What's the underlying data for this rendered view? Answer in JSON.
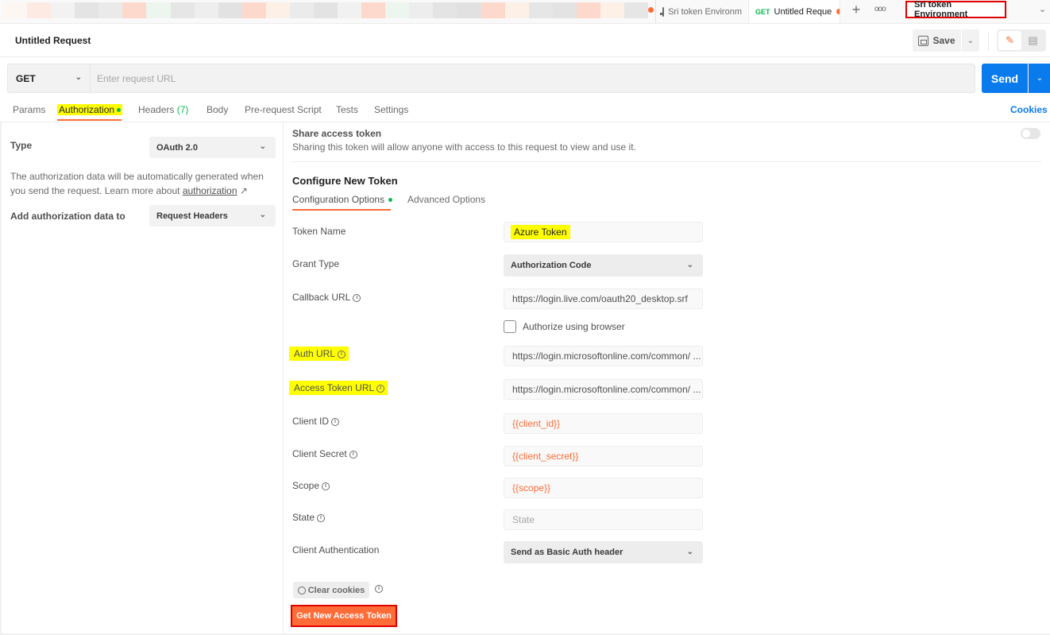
{
  "tabstrip": {
    "env_tab_label": "Sri token Environm",
    "active_tab_method": "GET",
    "active_tab_label": "Untitled Reque",
    "new_tab_icon": "+",
    "more_icon": "ooo",
    "environment_selector": "Sri token Environment",
    "env_chevron": "⌄"
  },
  "header": {
    "title": "Untitled Request",
    "save_label": "Save",
    "chevron": "⌄",
    "edit_icon": "✎",
    "comment_icon": "▤"
  },
  "url_bar": {
    "method": "GET",
    "method_chevron": "⌄",
    "url_value": "",
    "url_placeholder": "Enter request URL",
    "send_label": "Send",
    "send_chevron": "⌄"
  },
  "request_tabs": {
    "params": "Params",
    "authorization": "Authorization",
    "headers": "Headers",
    "headers_count": "(7)",
    "body": "Body",
    "pre_request": "Pre-request Script",
    "tests": "Tests",
    "settings": "Settings",
    "cookies": "Cookies"
  },
  "left_panel": {
    "type_label": "Type",
    "type_value": "OAuth 2.0",
    "description": "The authorization data will be automatically generated when you send the request. Learn more about ",
    "description_link": "authorization",
    "link_arrow": "↗",
    "add_to_label": "Add authorization data to",
    "add_to_value": "Request Headers",
    "chevron": "⌄"
  },
  "right_panel": {
    "share_title": "Share access token",
    "share_desc": "Sharing this token will allow anyone with access to this request to view and use it.",
    "share_enabled": false,
    "configure_title": "Configure New Token",
    "subtabs": {
      "config": "Configuration Options",
      "advanced": "Advanced Options"
    },
    "info_glyph": "i",
    "chevron": "⌄",
    "fields": {
      "token_name": {
        "label": "Token Name",
        "value": "Azure Token"
      },
      "grant_type": {
        "label": "Grant Type",
        "value": "Authorization Code"
      },
      "callback_url": {
        "label": "Callback URL",
        "value": "https://login.live.com/oauth20_desktop.srf"
      },
      "authorize_browser": {
        "label": "Authorize using browser",
        "checked": false
      },
      "auth_url": {
        "label": "Auth URL",
        "value": "https://login.microsoftonline.com/common/ ..."
      },
      "access_token_url": {
        "label": "Access Token URL",
        "value": "https://login.microsoftonline.com/common/ ..."
      },
      "client_id": {
        "label": "Client ID",
        "value": "{{client_id}}"
      },
      "client_secret": {
        "label": "Client Secret",
        "value": "{{client_secret}}"
      },
      "scope": {
        "label": "Scope",
        "value": "{{scope}}"
      },
      "state": {
        "label": "State",
        "value": "",
        "placeholder": "State"
      },
      "client_auth": {
        "label": "Client Authentication",
        "value": "Send as Basic Auth header"
      }
    },
    "clear_cookies": "Clear cookies",
    "get_token": "Get New Access Token"
  },
  "colors": {
    "accent_orange": "#ff6c37",
    "send_blue": "#097bed",
    "success_green": "#0cbb52",
    "highlight_yellow": "#ffff00",
    "annotation_red": "#e00000"
  }
}
